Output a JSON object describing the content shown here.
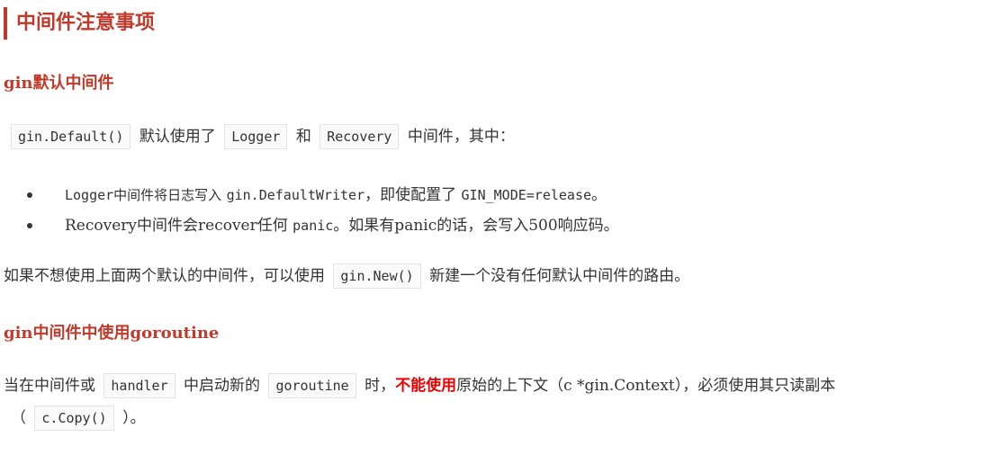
{
  "heading": "中间件注意事项",
  "section1": {
    "title": "gin默认中间件",
    "p1": {
      "code_default": "gin.Default()",
      "t1": "默认使用了",
      "code_logger": "Logger",
      "t2": "和",
      "code_recovery": "Recovery",
      "t3": "中间件，其中："
    },
    "bullets": [
      {
        "a": "Logger中间件将日志写入",
        "code": "gin.DefaultWriter",
        "b": "，即使配置了",
        "code2": "GIN_MODE=release",
        "c": "。"
      },
      {
        "a": "Recovery中间件会recover任何",
        "code": "panic",
        "b": "。如果有panic的话，会写入500响应码。"
      }
    ],
    "p2": {
      "t1": "如果不想使用上面两个默认的中间件，可以使用",
      "code": "gin.New()",
      "t2": "新建一个没有任何默认中间件的路由。"
    }
  },
  "section2": {
    "title": "gin中间件中使用goroutine",
    "p1": {
      "t1": "当在中间件或",
      "code_handler": "handler",
      "t2": "中启动新的",
      "code_goroutine": "goroutine",
      "t3": "时，",
      "emph": "不能使用",
      "t4": "原始的上下文（c *gin.Context），必须使用其只读副本",
      "t5": "（",
      "code_copy": "c.Copy()",
      "t6": "）。"
    }
  }
}
